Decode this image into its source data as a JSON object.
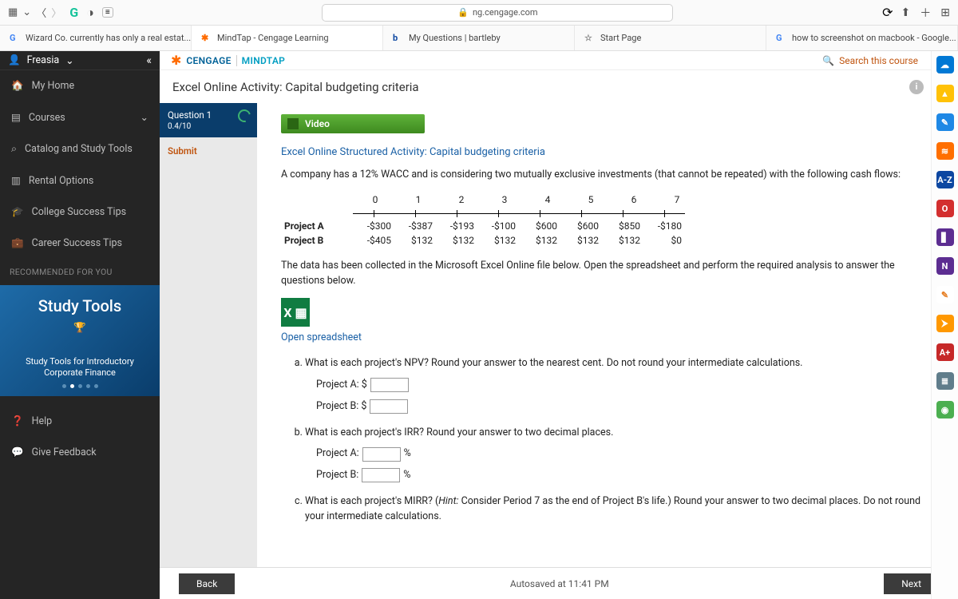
{
  "browser": {
    "url": "ng.cengage.com",
    "tabs": [
      {
        "label": "Wizard Co. currently has only a real estat...",
        "fav": "G",
        "favColor": "#4285f4"
      },
      {
        "label": "MindTap - Cengage Learning",
        "fav": "✱",
        "favColor": "#ff6b00"
      },
      {
        "label": "My Questions | bartleby",
        "fav": "b",
        "favColor": "#0d47a1"
      },
      {
        "label": "Start Page",
        "fav": "☆",
        "favColor": "#888"
      },
      {
        "label": "how to screenshot on macbook - Google...",
        "fav": "G",
        "favColor": "#4285f4"
      }
    ]
  },
  "sidebar": {
    "user": "Freasia",
    "items": [
      {
        "icon": "🏠",
        "label": "My Home"
      },
      {
        "icon": "▤",
        "label": "Courses",
        "chev": true
      },
      {
        "icon": "⌕",
        "label": "Catalog and Study Tools"
      },
      {
        "icon": "▥",
        "label": "Rental Options"
      },
      {
        "icon": "🎓",
        "label": "College Success Tips"
      },
      {
        "icon": "💼",
        "label": "Career Success Tips"
      }
    ],
    "rec": "RECOMMENDED FOR YOU",
    "cardTitle": "Study Tools",
    "cardSub": "Study Tools for Introductory Corporate Finance",
    "help": "Help",
    "feedback": "Give Feedback"
  },
  "brand": {
    "cen": "CENGAGE",
    "mt": "MINDTAP",
    "search": "Search this course"
  },
  "page": {
    "title": "Excel Online Activity: Capital budgeting criteria"
  },
  "question": {
    "label": "Question 1",
    "progress": "0.4/10",
    "submit": "Submit"
  },
  "video": {
    "label": "Video"
  },
  "activity": {
    "heading": "Excel Online Structured Activity: Capital budgeting criteria",
    "intro": "A company has a 12% WACC and is considering two mutually exclusive investments (that cannot be repeated) with the following cash flows:",
    "periods": [
      "0",
      "1",
      "2",
      "3",
      "4",
      "5",
      "6",
      "7"
    ],
    "rows": [
      {
        "name": "Project A",
        "vals": [
          "-$300",
          "-$387",
          "-$193",
          "-$100",
          "$600",
          "$600",
          "$850",
          "-$180"
        ]
      },
      {
        "name": "Project B",
        "vals": [
          "-$405",
          "$132",
          "$132",
          "$132",
          "$132",
          "$132",
          "$132",
          "$0"
        ]
      }
    ],
    "collected": "The data has been collected in the Microsoft Excel Online file below. Open the spreadsheet and perform the required analysis to answer the questions below.",
    "open": "Open spreadsheet",
    "qa": {
      "text": "What is each project's NPV? Round your answer to the nearest cent. Do not round your intermediate calculations.",
      "rowA": "Project A: $",
      "rowB": "Project B: $"
    },
    "qb": {
      "text": "What is each project's IRR? Round your answer to two decimal places.",
      "rowA": "Project A:",
      "rowB": "Project B:",
      "unit": "%"
    },
    "qc": {
      "text_pre": "What is each project's MIRR? (",
      "hint": "Hint:",
      "text_post": " Consider Period 7 as the end of Project B's life.) Round your answer to two decimal places. Do not round your intermediate calculations."
    }
  },
  "footer": {
    "back": "Back",
    "next": "Next",
    "autosave": "Autosaved at 11:41 PM"
  },
  "rail_icons": [
    {
      "bg": "#0078d4",
      "t": "☁"
    },
    {
      "bg": "#ffc107",
      "t": "▲"
    },
    {
      "bg": "#1e88e5",
      "t": "✎"
    },
    {
      "bg": "#ff6f00",
      "t": "≋"
    },
    {
      "bg": "#0d47a1",
      "t": "A-Z"
    },
    {
      "bg": "#d32f2f",
      "t": "O"
    },
    {
      "bg": "#5c2d91",
      "t": "▋"
    },
    {
      "bg": "#5c2d91",
      "t": "N"
    },
    {
      "bg": "#fff",
      "t": "✎",
      "fg": "#e67e22"
    },
    {
      "bg": "#ff9800",
      "t": "⮞"
    },
    {
      "bg": "#c62828",
      "t": "A+"
    },
    {
      "bg": "#607d8b",
      "t": "≣"
    },
    {
      "bg": "#4caf50",
      "t": "◉"
    }
  ]
}
